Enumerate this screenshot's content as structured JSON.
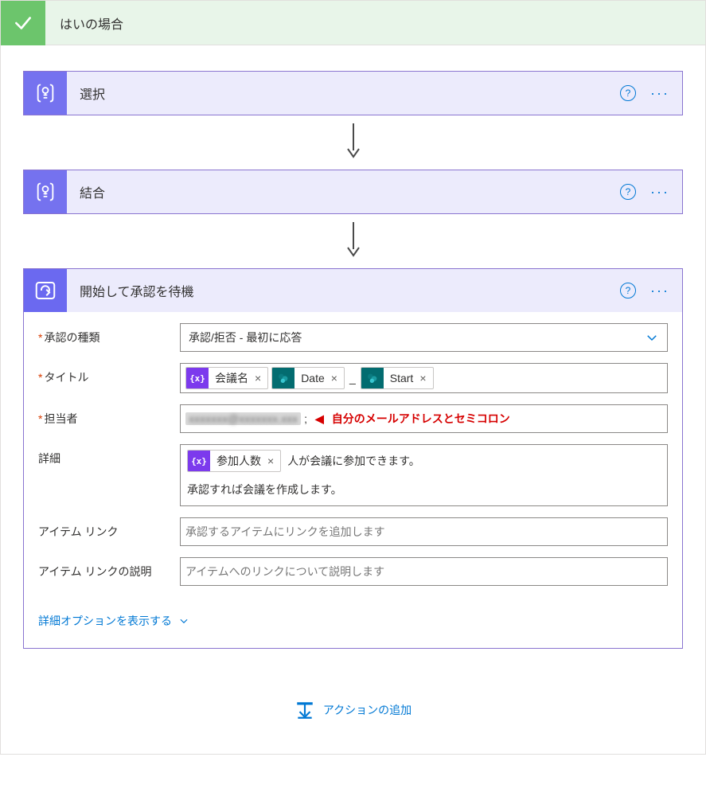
{
  "header": {
    "title": "はいの場合"
  },
  "actions": {
    "select": {
      "title": "選択"
    },
    "join": {
      "title": "結合"
    },
    "approval": {
      "title": "開始して承認を待機"
    }
  },
  "form": {
    "approvalType": {
      "label": "承認の種類",
      "value": "承認/拒否 - 最初に応答"
    },
    "title": {
      "label": "タイトル",
      "tokens": {
        "meeting": "会議名",
        "date": "Date",
        "start": "Start"
      },
      "separator": "_"
    },
    "assignee": {
      "label": "担当者",
      "redacted": "xxxxxxx@xxxxxxx.xxx",
      "suffix": ";",
      "note_arrow": "◀",
      "note": "自分のメールアドレスとセミコロン"
    },
    "details": {
      "label": "詳細",
      "tokens": {
        "participants": "参加人数"
      },
      "line1_suffix": "人が会議に参加できます。",
      "line2": "承認すれば会議を作成します。"
    },
    "itemLink": {
      "label": "アイテム リンク",
      "placeholder": "承認するアイテムにリンクを追加します"
    },
    "itemLinkDesc": {
      "label": "アイテム リンクの説明",
      "placeholder": "アイテムへのリンクについて説明します"
    },
    "advanced": "詳細オプションを表示する"
  },
  "footer": {
    "addAction": "アクションの追加"
  },
  "icons": {
    "expr": "{x}",
    "sp": "s"
  }
}
